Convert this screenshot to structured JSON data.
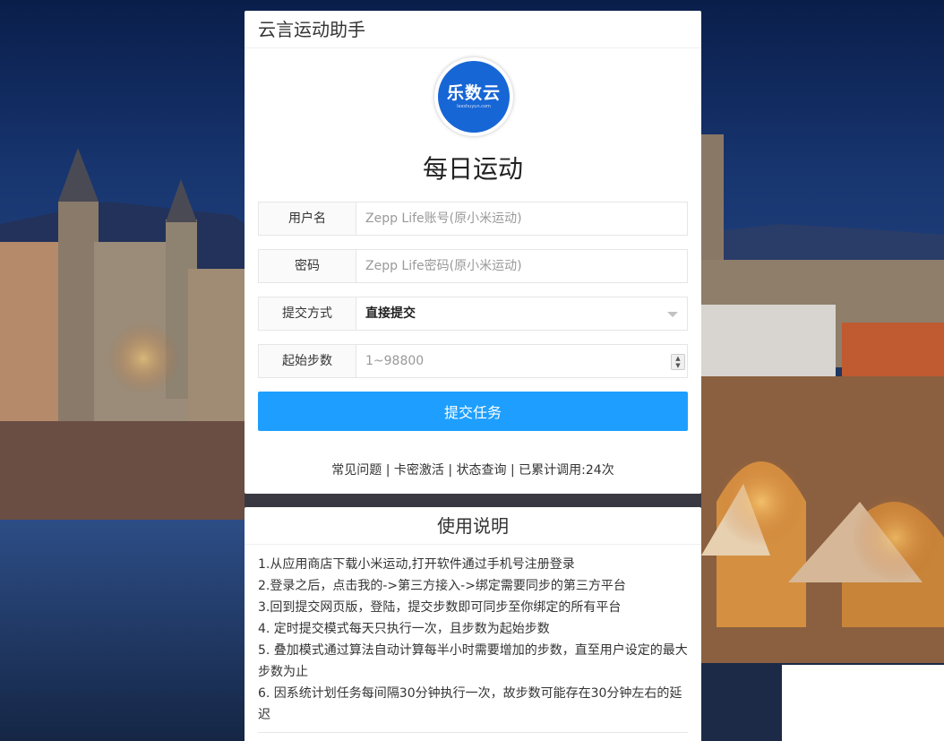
{
  "app": {
    "title": "云言运动助手",
    "logo_text": "乐数云",
    "logo_subtext": "lexshuyun.com",
    "page_title": "每日运动"
  },
  "form": {
    "username": {
      "label": "用户名",
      "placeholder": "Zepp Life账号(原小米运动)",
      "value": ""
    },
    "password": {
      "label": "密码",
      "placeholder": "Zepp Life密码(原小米运动)",
      "value": ""
    },
    "submit_mode": {
      "label": "提交方式",
      "selected": "直接提交"
    },
    "start_steps": {
      "label": "起始步数",
      "placeholder": "1~98800",
      "value": ""
    },
    "submit_label": "提交任务"
  },
  "footer": {
    "faq": "常见问题",
    "sep1": " | ",
    "activate": "卡密激活",
    "sep2": " | ",
    "status": "状态查询",
    "sep3": " | ",
    "count_text": "已累计调用:24次"
  },
  "help": {
    "title": "使用说明",
    "items": [
      "1.从应用商店下载小米运动,打开软件通过手机号注册登录",
      "2.登录之后，点击我的->第三方接入->绑定需要同步的第三方平台",
      "3.回到提交网页版，登陆，提交步数即可同步至你绑定的所有平台",
      "4. 定时提交模式每天只执行一次，且步数为起始步数",
      "5. 叠加模式通过算法自动计算每半小时需要增加的步数，直至用户设定的最大步数为止",
      "6. 因系统计划任务每间隔30分钟执行一次，故步数可能存在30分钟左右的延迟"
    ]
  },
  "colors": {
    "primary_button": "#1e9fff",
    "logo_bg": "#1766d6"
  }
}
